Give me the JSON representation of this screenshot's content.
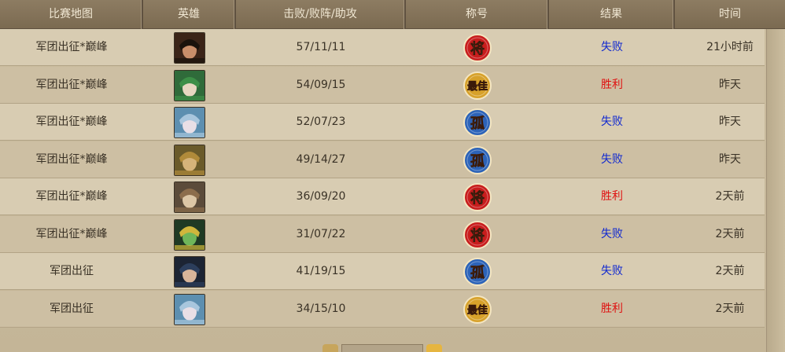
{
  "header": {
    "map": "比赛地图",
    "hero": "英雄",
    "kda": "击败/败阵/助攻",
    "title": "称号",
    "result": "结果",
    "time": "时间"
  },
  "badges": {
    "jiang": {
      "text": "将",
      "color": "#c81d1d"
    },
    "best": {
      "text": "最佳",
      "color": "#d7a12a"
    },
    "gu": {
      "text": "孤",
      "color": "#2c63b8"
    }
  },
  "colors": {
    "win": "#e01010",
    "lose": "#1028d0"
  },
  "rows": [
    {
      "map": "军团出征*巅峰",
      "hero": "hero-portrait-female-dark-hair",
      "kda": "57/11/11",
      "title": "jiang",
      "title_text": "将",
      "result": "失败",
      "result_type": "lose",
      "time": "21小时前"
    },
    {
      "map": "军团出征*巅峰",
      "hero": "hero-portrait-green-warrior",
      "kda": "54/09/15",
      "title": "best",
      "title_text": "最佳",
      "result": "胜利",
      "result_type": "win",
      "time": "昨天"
    },
    {
      "map": "军团出征*巅峰",
      "hero": "hero-portrait-blue-hair",
      "kda": "52/07/23",
      "title": "gu",
      "title_text": "孤",
      "result": "失败",
      "result_type": "lose",
      "time": "昨天"
    },
    {
      "map": "军团出征*巅峰",
      "hero": "hero-portrait-golden-armor",
      "kda": "49/14/27",
      "title": "gu",
      "title_text": "孤",
      "result": "失败",
      "result_type": "lose",
      "time": "昨天"
    },
    {
      "map": "军团出征*巅峰",
      "hero": "hero-portrait-winged-helm",
      "kda": "36/09/20",
      "title": "jiang",
      "title_text": "将",
      "result": "胜利",
      "result_type": "win",
      "time": "2天前"
    },
    {
      "map": "军团出征*巅峰",
      "hero": "hero-portrait-green-monster",
      "kda": "31/07/22",
      "title": "jiang",
      "title_text": "将",
      "result": "失败",
      "result_type": "lose",
      "time": "2天前"
    },
    {
      "map": "军团出征",
      "hero": "hero-portrait-dark-hair-male",
      "kda": "41/19/15",
      "title": "gu",
      "title_text": "孤",
      "result": "失败",
      "result_type": "lose",
      "time": "2天前"
    },
    {
      "map": "军团出征",
      "hero": "hero-portrait-blue-hair",
      "kda": "34/15/10",
      "title": "best",
      "title_text": "最佳",
      "result": "胜利",
      "result_type": "win",
      "time": "2天前"
    }
  ]
}
